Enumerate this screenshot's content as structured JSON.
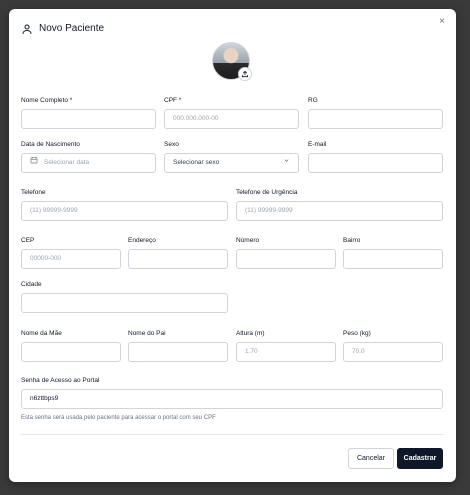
{
  "dialog": {
    "title": "Novo Paciente",
    "close_label": "×"
  },
  "fields": {
    "nome_completo": {
      "label": "Nome Completo *",
      "value": "",
      "placeholder": ""
    },
    "cpf": {
      "label": "CPF *",
      "value": "",
      "placeholder": "000.000.000-00"
    },
    "rg": {
      "label": "RG",
      "value": "",
      "placeholder": ""
    },
    "data_nascimento": {
      "label": "Data de Nascimento",
      "placeholder": "Selecionar data"
    },
    "sexo": {
      "label": "Sexo",
      "placeholder": "Selecionar sexo"
    },
    "email": {
      "label": "E-mail",
      "value": "",
      "placeholder": ""
    },
    "telefone": {
      "label": "Telefone",
      "value": "",
      "placeholder": "(11) 99999-9999"
    },
    "telefone_urgencia": {
      "label": "Telefone de Urgência",
      "value": "",
      "placeholder": "(11) 99999-9999"
    },
    "cep": {
      "label": "CEP",
      "value": "",
      "placeholder": "00000-000"
    },
    "endereco": {
      "label": "Endereço",
      "value": "",
      "placeholder": ""
    },
    "numero": {
      "label": "Número",
      "value": "",
      "placeholder": ""
    },
    "bairro": {
      "label": "Bairro",
      "value": "",
      "placeholder": ""
    },
    "cidade": {
      "label": "Cidade",
      "value": "",
      "placeholder": ""
    },
    "nome_mae": {
      "label": "Nome da Mãe",
      "value": "",
      "placeholder": ""
    },
    "nome_pai": {
      "label": "Nome do Pai",
      "value": "",
      "placeholder": ""
    },
    "altura": {
      "label": "Altura (m)",
      "value": "",
      "placeholder": "1.70"
    },
    "peso": {
      "label": "Peso (kg)",
      "value": "",
      "placeholder": "70.0"
    },
    "senha": {
      "label": "Senha de Acesso ao Portal",
      "value": "n6zttbps9",
      "hint": "Esta senha será usada pelo paciente para acessar o portal com seu CPF"
    }
  },
  "actions": {
    "cancel_label": "Cancelar",
    "submit_label": "Cadastrar"
  },
  "icons": {
    "header": "user-icon",
    "avatar_upload": "upload-icon",
    "date": "calendar-icon",
    "select": "chevron-down-icon"
  },
  "colors": {
    "primary": "#0f172a",
    "border": "#d1d5db",
    "placeholder": "#9ca3af",
    "backdrop": "#3a3a3a"
  }
}
